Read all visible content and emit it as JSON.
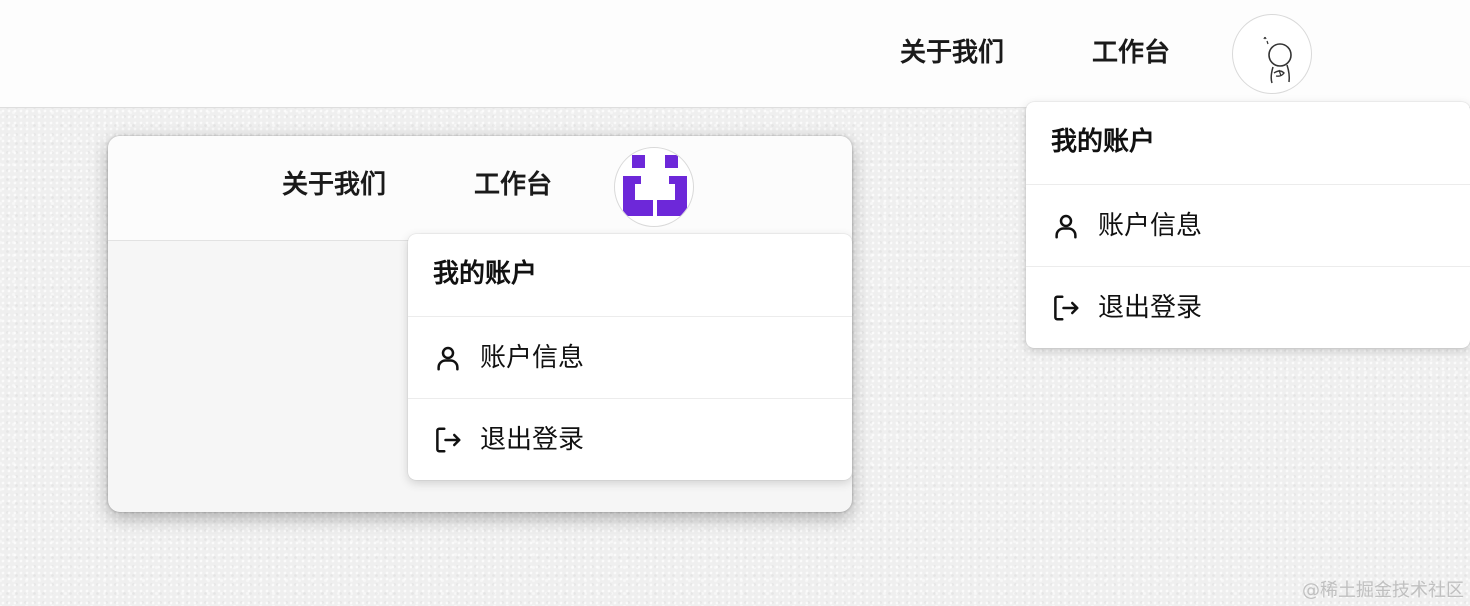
{
  "header": {
    "nav_about": "关于我们",
    "nav_workbench": "工作台"
  },
  "menu": {
    "title": "我的账户",
    "items": [
      {
        "label": "账户信息",
        "icon": "user-icon"
      },
      {
        "label": "退出登录",
        "icon": "logout-icon"
      }
    ]
  },
  "preview": {
    "nav_about": "关于我们",
    "nav_workbench": "工作台",
    "menu": {
      "title": "我的账户",
      "items": [
        {
          "label": "账户信息",
          "icon": "user-icon"
        },
        {
          "label": "退出登录",
          "icon": "logout-icon"
        }
      ]
    },
    "avatar_color": "#6d28d9"
  },
  "watermark": "@稀土掘金技术社区"
}
